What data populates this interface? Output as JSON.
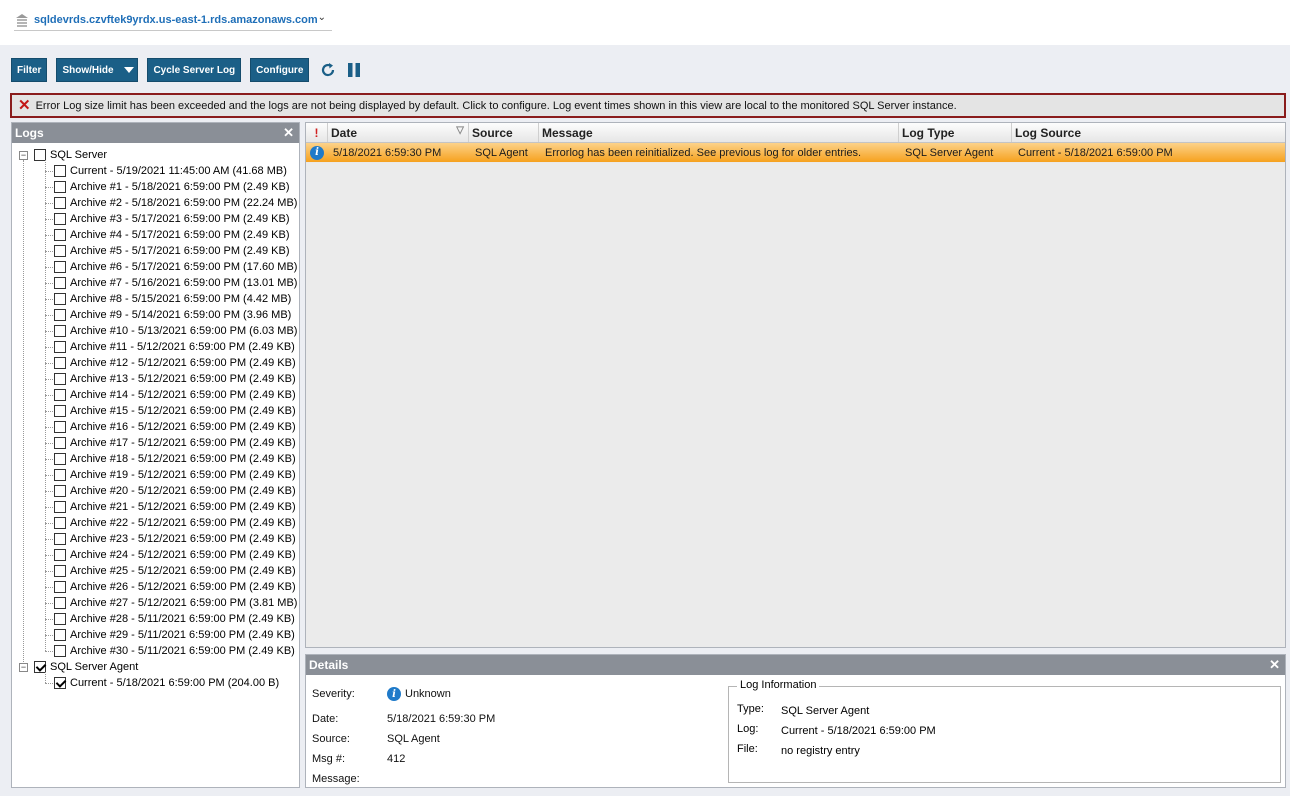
{
  "server": {
    "name": "sqldevrds.czvftek9yrdx.us-east-1.rds.amazonaws.com"
  },
  "toolbar": {
    "filter": "Filter",
    "show_hide": "Show/Hide",
    "cycle": "Cycle Server Log",
    "configure": "Configure"
  },
  "alert": {
    "text": "Error Log size limit has been exceeded and the logs are not being displayed by default. Click to configure. Log event times shown in this view are local to the monitored SQL Server instance."
  },
  "logs": {
    "title": "Logs",
    "groups": [
      {
        "label": "SQL Server",
        "checked": false,
        "items": [
          {
            "label": "Current - 5/19/2021 11:45:00 AM (41.68 MB)",
            "checked": false
          },
          {
            "label": "Archive #1 - 5/18/2021 6:59:00 PM (2.49 KB)",
            "checked": false
          },
          {
            "label": "Archive #2 - 5/18/2021 6:59:00 PM (22.24 MB)",
            "checked": false
          },
          {
            "label": "Archive #3 - 5/17/2021 6:59:00 PM (2.49 KB)",
            "checked": false
          },
          {
            "label": "Archive #4 - 5/17/2021 6:59:00 PM (2.49 KB)",
            "checked": false
          },
          {
            "label": "Archive #5 - 5/17/2021 6:59:00 PM (2.49 KB)",
            "checked": false
          },
          {
            "label": "Archive #6 - 5/17/2021 6:59:00 PM (17.60 MB)",
            "checked": false
          },
          {
            "label": "Archive #7 - 5/16/2021 6:59:00 PM (13.01 MB)",
            "checked": false
          },
          {
            "label": "Archive #8 - 5/15/2021 6:59:00 PM (4.42 MB)",
            "checked": false
          },
          {
            "label": "Archive #9 - 5/14/2021 6:59:00 PM (3.96 MB)",
            "checked": false
          },
          {
            "label": "Archive #10 - 5/13/2021 6:59:00 PM (6.03 MB)",
            "checked": false
          },
          {
            "label": "Archive #11 - 5/12/2021 6:59:00 PM (2.49 KB)",
            "checked": false
          },
          {
            "label": "Archive #12 - 5/12/2021 6:59:00 PM (2.49 KB)",
            "checked": false
          },
          {
            "label": "Archive #13 - 5/12/2021 6:59:00 PM (2.49 KB)",
            "checked": false
          },
          {
            "label": "Archive #14 - 5/12/2021 6:59:00 PM (2.49 KB)",
            "checked": false
          },
          {
            "label": "Archive #15 - 5/12/2021 6:59:00 PM (2.49 KB)",
            "checked": false
          },
          {
            "label": "Archive #16 - 5/12/2021 6:59:00 PM (2.49 KB)",
            "checked": false
          },
          {
            "label": "Archive #17 - 5/12/2021 6:59:00 PM (2.49 KB)",
            "checked": false
          },
          {
            "label": "Archive #18 - 5/12/2021 6:59:00 PM (2.49 KB)",
            "checked": false
          },
          {
            "label": "Archive #19 - 5/12/2021 6:59:00 PM (2.49 KB)",
            "checked": false
          },
          {
            "label": "Archive #20 - 5/12/2021 6:59:00 PM (2.49 KB)",
            "checked": false
          },
          {
            "label": "Archive #21 - 5/12/2021 6:59:00 PM (2.49 KB)",
            "checked": false
          },
          {
            "label": "Archive #22 - 5/12/2021 6:59:00 PM (2.49 KB)",
            "checked": false
          },
          {
            "label": "Archive #23 - 5/12/2021 6:59:00 PM (2.49 KB)",
            "checked": false
          },
          {
            "label": "Archive #24 - 5/12/2021 6:59:00 PM (2.49 KB)",
            "checked": false
          },
          {
            "label": "Archive #25 - 5/12/2021 6:59:00 PM (2.49 KB)",
            "checked": false
          },
          {
            "label": "Archive #26 - 5/12/2021 6:59:00 PM (2.49 KB)",
            "checked": false
          },
          {
            "label": "Archive #27 - 5/12/2021 6:59:00 PM (3.81 MB)",
            "checked": false
          },
          {
            "label": "Archive #28 - 5/11/2021 6:59:00 PM (2.49 KB)",
            "checked": false
          },
          {
            "label": "Archive #29 - 5/11/2021 6:59:00 PM (2.49 KB)",
            "checked": false
          },
          {
            "label": "Archive #30 - 5/11/2021 6:59:00 PM (2.49 KB)",
            "checked": false
          }
        ]
      },
      {
        "label": "SQL Server Agent",
        "checked": true,
        "items": [
          {
            "label": "Current - 5/18/2021 6:59:00 PM (204.00 B)",
            "checked": true
          }
        ]
      }
    ]
  },
  "grid": {
    "columns": [
      "Date",
      "Source",
      "Message",
      "Log Type",
      "Log Source"
    ],
    "rows": [
      {
        "date": "5/18/2021 6:59:30 PM",
        "source": "SQL Agent",
        "message": "Errorlog has been reinitialized.  See previous log for older entries.",
        "log_type": "SQL Server Agent",
        "log_source": "Current - 5/18/2021 6:59:00 PM"
      }
    ]
  },
  "details": {
    "title": "Details",
    "severity_label": "Severity:",
    "severity": "Unknown",
    "date_label": "Date:",
    "date": "5/18/2021 6:59:30 PM",
    "source_label": "Source:",
    "source": "SQL Agent",
    "msg_label": "Msg #:",
    "msg": "412",
    "message_label": "Message:",
    "log_info": {
      "legend": "Log Information",
      "type_label": "Type:",
      "type": "SQL Server Agent",
      "log_label": "Log:",
      "log": "Current - 5/18/2021 6:59:00 PM",
      "file_label": "File:",
      "file": "no registry entry"
    }
  },
  "colors": {
    "toolbar_button": "#1b5f87",
    "alert_border": "#8a1c1c",
    "row_highlight": "#f6a11e",
    "panel_header": "#8a8f97",
    "link_blue": "#1f6fb8"
  }
}
